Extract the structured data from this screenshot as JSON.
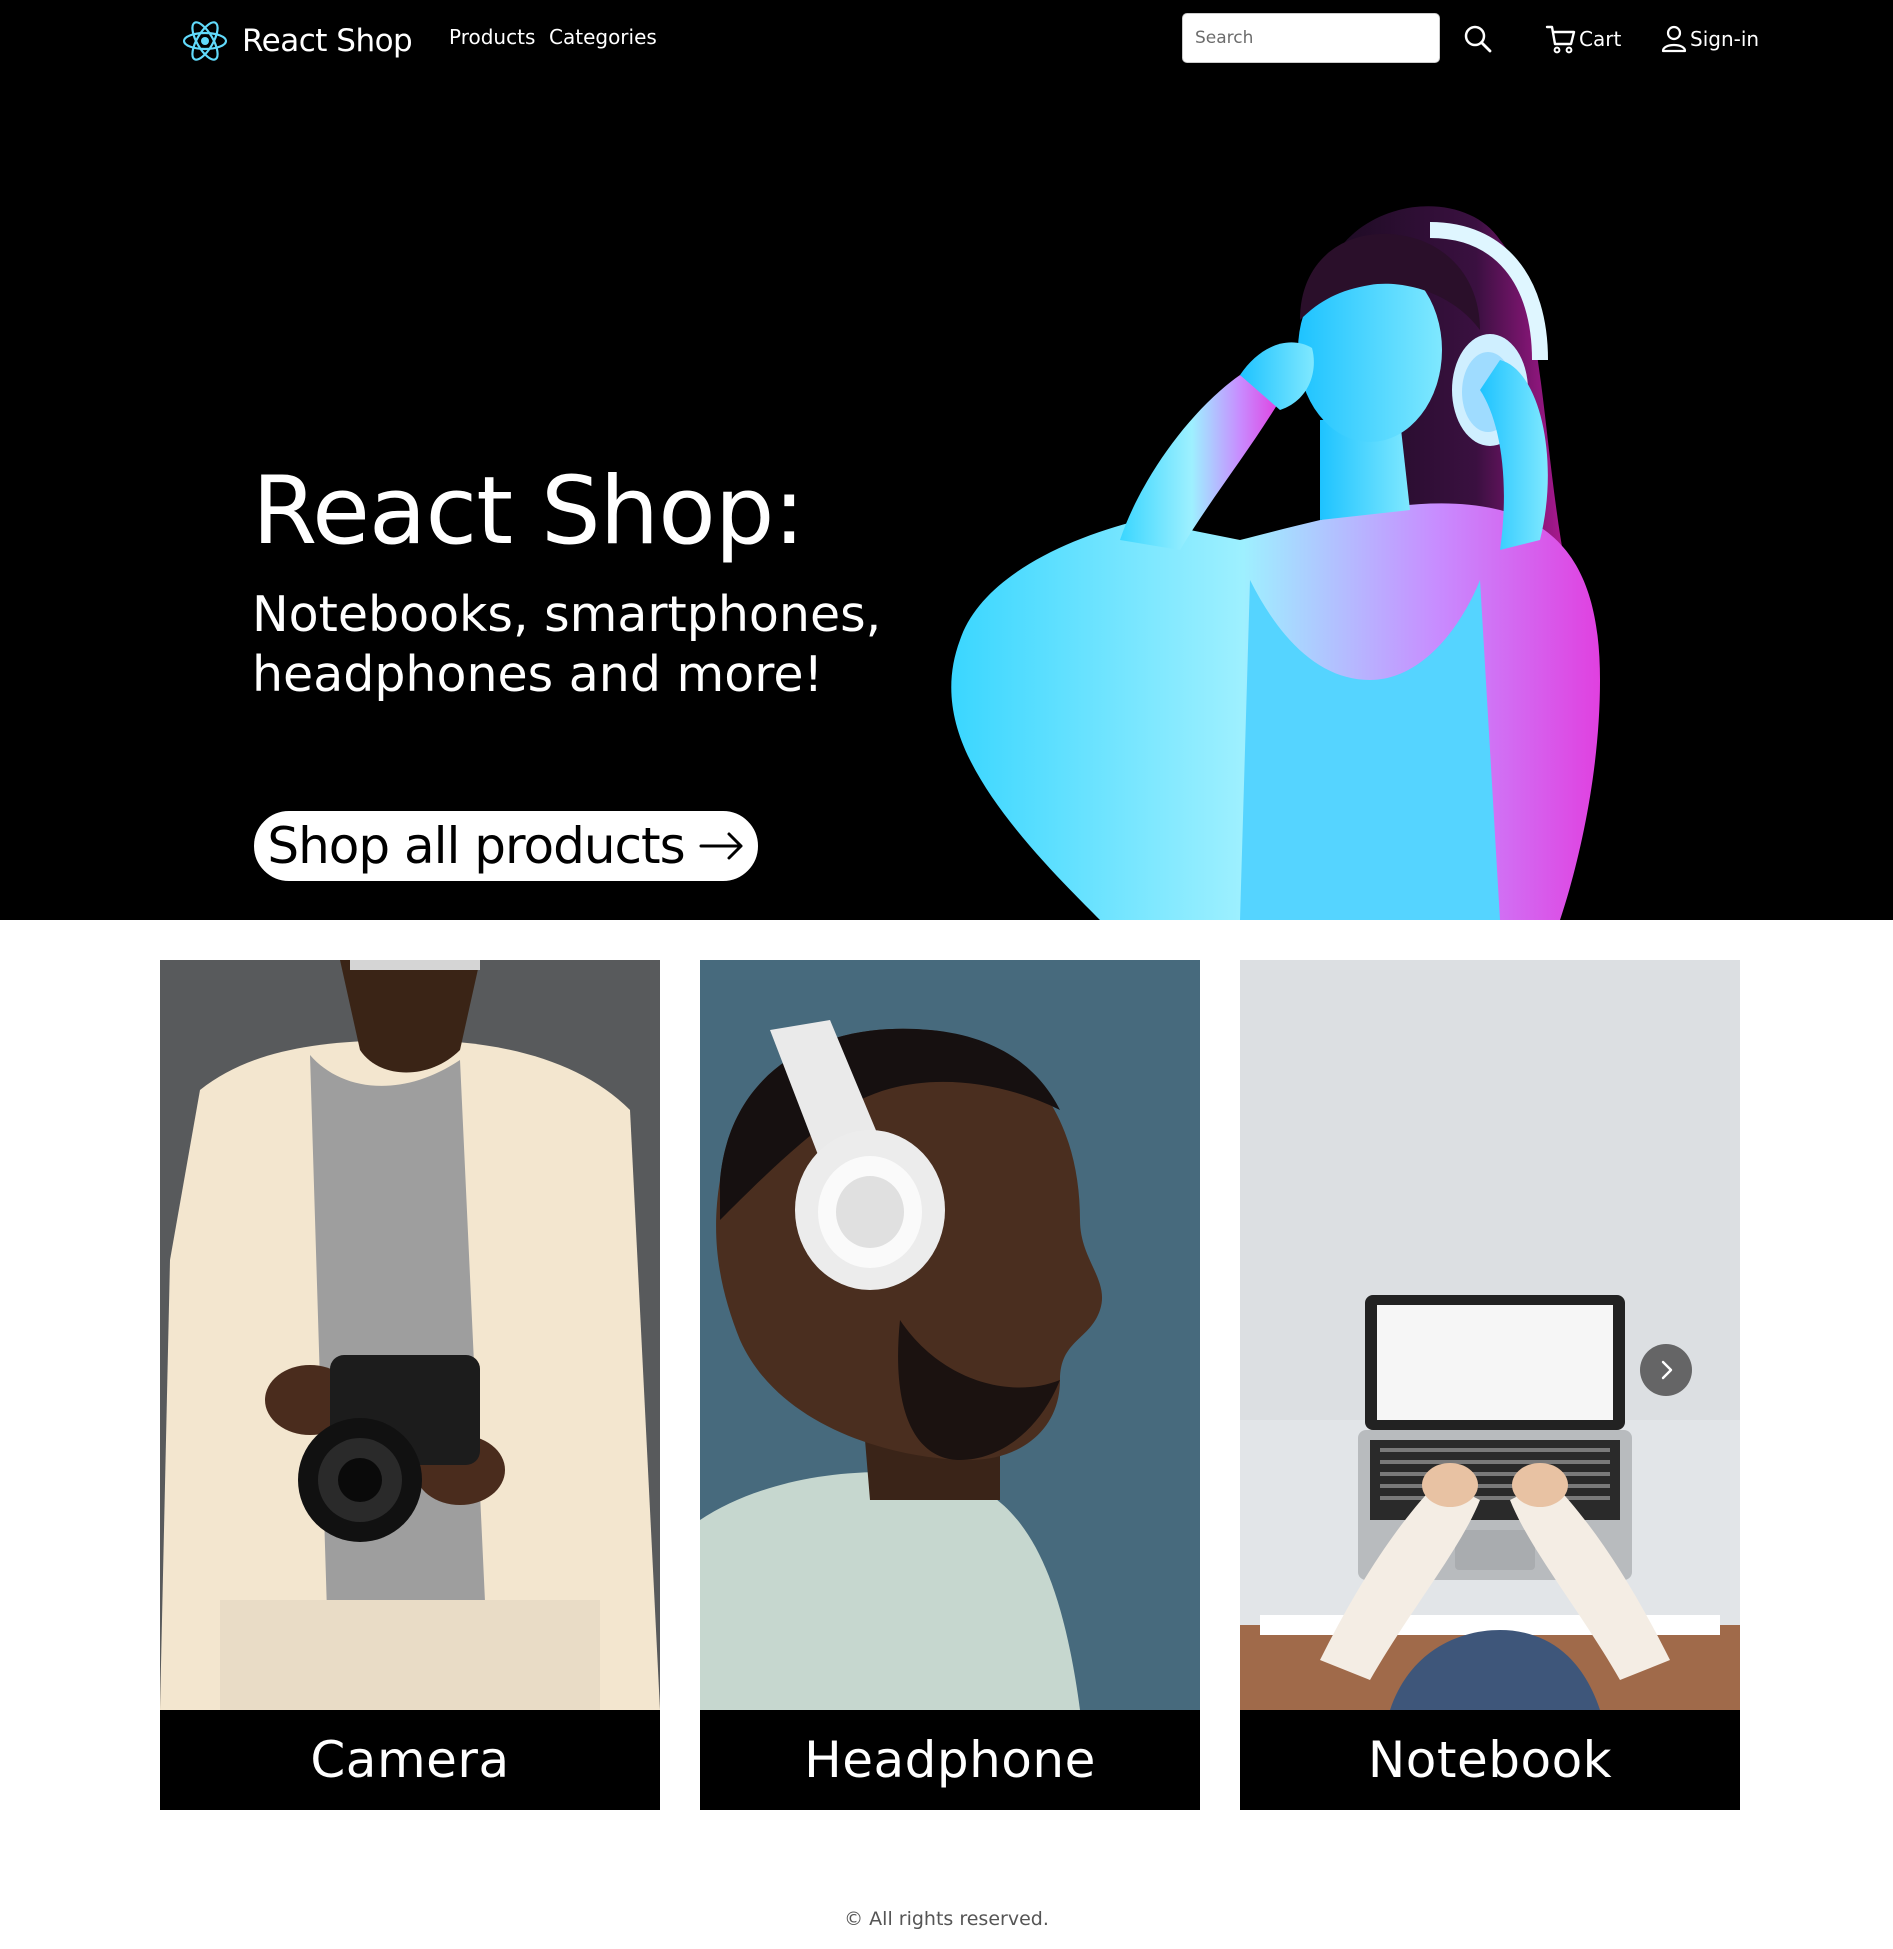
{
  "navbar": {
    "brand": "React Shop",
    "links": [
      {
        "label": "Products"
      },
      {
        "label": "Categories"
      }
    ],
    "search": {
      "placeholder": "Search",
      "value": ""
    },
    "cart_label": "Cart",
    "signin_label": "Sign-in",
    "icons": {
      "logo": "react-atom-icon",
      "search": "search-icon",
      "cart": "cart-icon",
      "user": "user-icon"
    }
  },
  "hero": {
    "title": "React Shop:",
    "subtitle": "Notebooks, smartphones, headphones and more!",
    "cta_label": "Shop all products",
    "cta_icon": "arrow-right-icon"
  },
  "categories": [
    {
      "label": "Camera"
    },
    {
      "label": "Headphone"
    },
    {
      "label": "Notebook"
    }
  ],
  "carousel": {
    "next_icon": "chevron-right-icon"
  },
  "footer": {
    "text": "© All rights reserved."
  },
  "colors": {
    "brand_logo": "#61dafb",
    "navbar_bg": "#000000",
    "hero_bg": "#000000",
    "label_bg": "#000000"
  }
}
